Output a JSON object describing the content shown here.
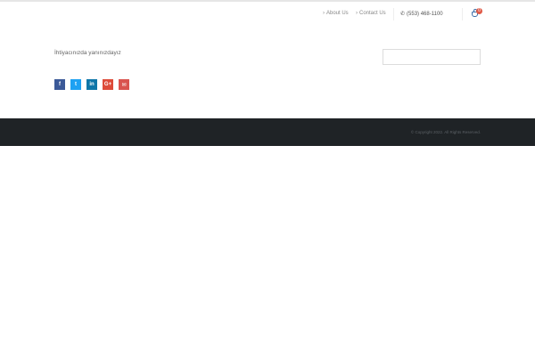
{
  "topbar": {
    "nav": [
      {
        "label": "About Us",
        "chevron": "›"
      },
      {
        "label": "Contact Us",
        "chevron": "›"
      }
    ],
    "phone": {
      "icon": "phone-icon",
      "glyph": "✆",
      "number": "(553) 468-1100"
    },
    "cart": {
      "icon": "shopping-bag-icon",
      "count": "0",
      "accent": "#3b6ea8",
      "badge_color": "#e05a47"
    }
  },
  "main": {
    "tagline": "İhtiyacınızda yanınızdayız",
    "search": {
      "placeholder": ""
    },
    "social": [
      {
        "name": "facebook-icon",
        "glyph": "f",
        "color": "#3b5998"
      },
      {
        "name": "twitter-icon",
        "glyph": "t",
        "color": "#1da1f2"
      },
      {
        "name": "linkedin-icon",
        "glyph": "in",
        "color": "#0e76a8"
      },
      {
        "name": "google-plus-icon",
        "glyph": "G+",
        "color": "#dd4b39"
      },
      {
        "name": "email-icon",
        "glyph": "✉",
        "color": "#d9534f"
      }
    ]
  },
  "footer": {
    "copyright": "© Copyright 2022. All Rights Reserved.",
    "background": "#1f2326"
  }
}
